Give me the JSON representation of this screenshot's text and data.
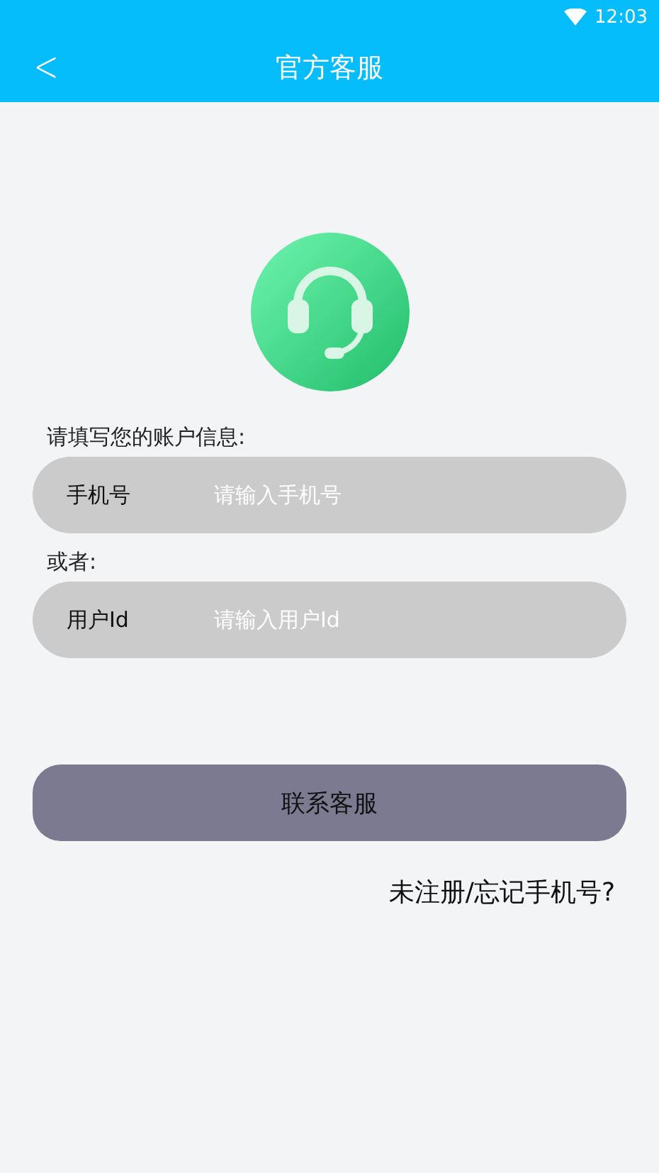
{
  "status_bar": {
    "time": "12:03"
  },
  "header": {
    "back": "<",
    "title": "官方客服"
  },
  "fields": [
    {
      "caption": "请填写您的账户信息:",
      "label": "手机号",
      "placeholder": "请输入手机号"
    },
    {
      "caption": "或者:",
      "label": "用户Id",
      "placeholder": "请输入用户Id"
    }
  ],
  "button": "联系客服",
  "link": "未注册/忘记手机号?"
}
